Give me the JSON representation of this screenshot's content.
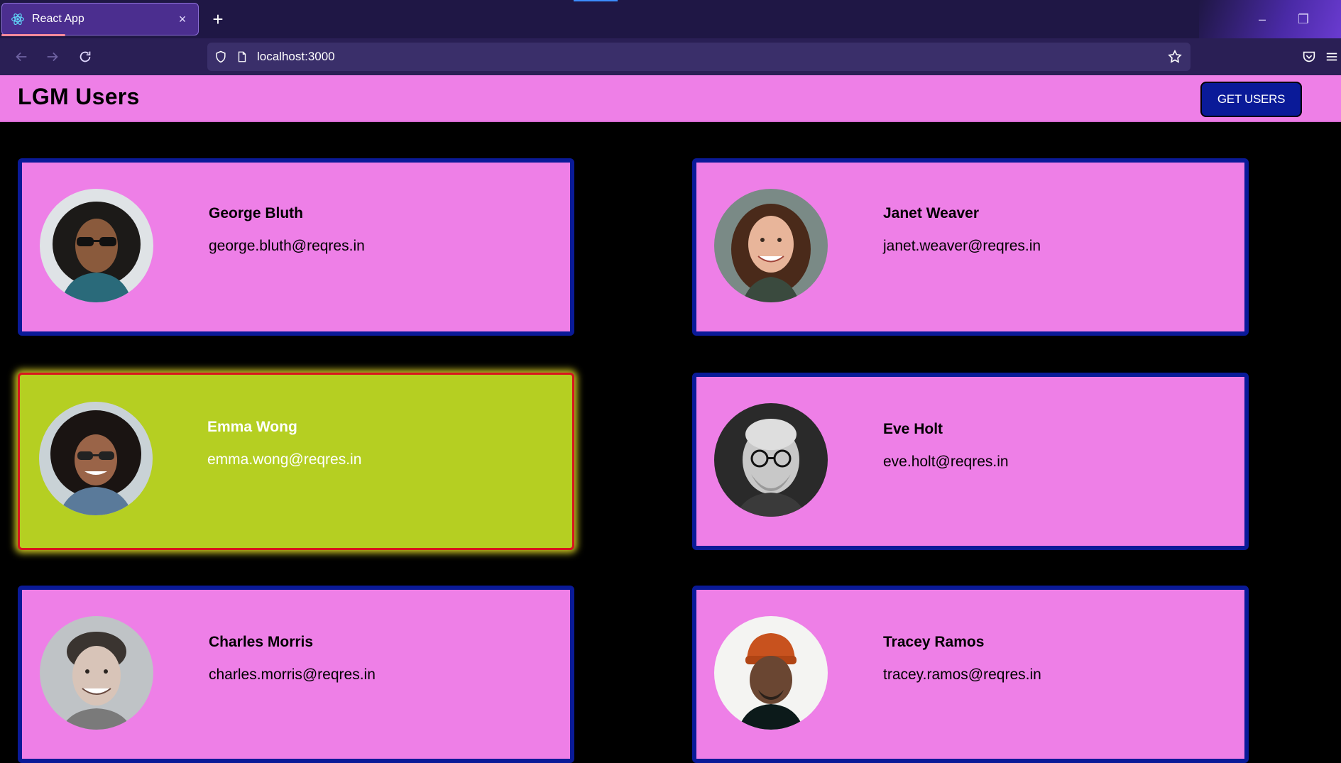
{
  "browser": {
    "tab_title": "React App",
    "tab_close": "×",
    "new_tab": "+",
    "url": "localhost:3000",
    "minimize": "–",
    "restore": "❐"
  },
  "app": {
    "title": "LGM Users",
    "get_users_label": "GET USERS"
  },
  "colors": {
    "header_bg": "#ee7fe7",
    "card_bg": "#ee7fe7",
    "card_border": "#0a1a98",
    "active_card_bg": "#b5cf22",
    "active_card_border": "#d8141e",
    "button_bg": "#0a1a98",
    "page_bg": "#000000"
  },
  "users": [
    {
      "name": "George Bluth",
      "email": "george.bluth@reqres.in"
    },
    {
      "name": "Janet Weaver",
      "email": "janet.weaver@reqres.in"
    },
    {
      "name": "Emma Wong",
      "email": "emma.wong@reqres.in"
    },
    {
      "name": "Eve Holt",
      "email": "eve.holt@reqres.in"
    },
    {
      "name": "Charles Morris",
      "email": "charles.morris@reqres.in"
    },
    {
      "name": "Tracey Ramos",
      "email": "tracey.ramos@reqres.in"
    }
  ]
}
